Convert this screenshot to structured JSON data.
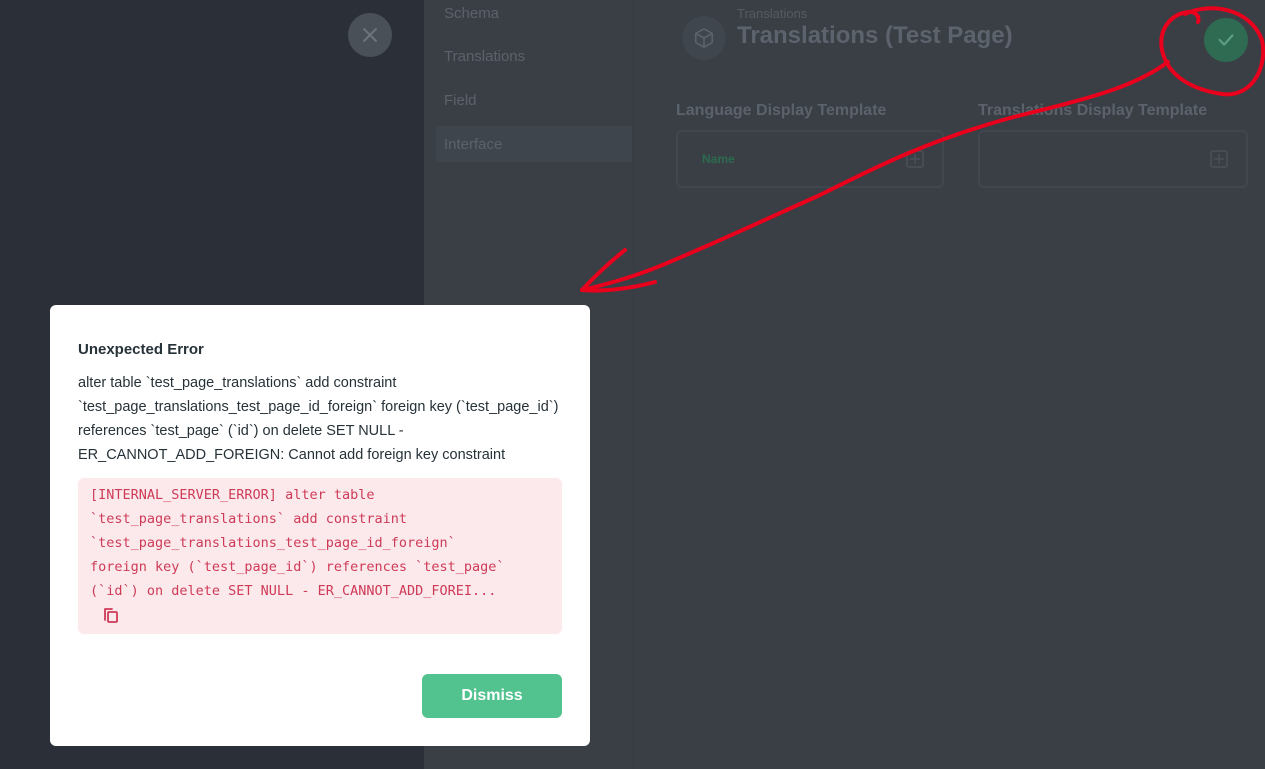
{
  "drawer": {
    "nav": [
      {
        "label": "Schema"
      },
      {
        "label": "Translations"
      },
      {
        "label": "Field"
      },
      {
        "label": "Interface"
      }
    ],
    "breadcrumb": "Translations",
    "title": "Translations (Test Page)",
    "fields": {
      "language_display_template_label": "Language Display Template",
      "language_display_template_chip": "Name",
      "translations_display_template_label": "Translations Display Template"
    }
  },
  "icons": {
    "close": "close-icon",
    "header": "box-icon",
    "save": "check-icon",
    "template": "expand-icon",
    "copy": "copy-icon"
  },
  "colors": {
    "dismiss": "#52c28f",
    "error_text": "#cf3b57",
    "error_bg": "#fbe9ec",
    "annotation": "#e8001c"
  },
  "modal": {
    "title": "Unexpected Error",
    "message": "alter table `test_page_translations` add constraint `test_page_translations_test_page_id_foreign` foreign key (`test_page_id`) references `test_page` (`id`) on delete SET NULL - ER_CANNOT_ADD_FOREIGN: Cannot add foreign key constraint",
    "error_detail": "[INTERNAL_SERVER_ERROR] alter table\n`test_page_translations` add constraint\n`test_page_translations_test_page_id_foreign`\nforeign key (`test_page_id`) references `test_page`\n(`id`) on delete SET NULL - ER_CANNOT_ADD_FOREI...",
    "dismiss_label": "Dismiss"
  }
}
